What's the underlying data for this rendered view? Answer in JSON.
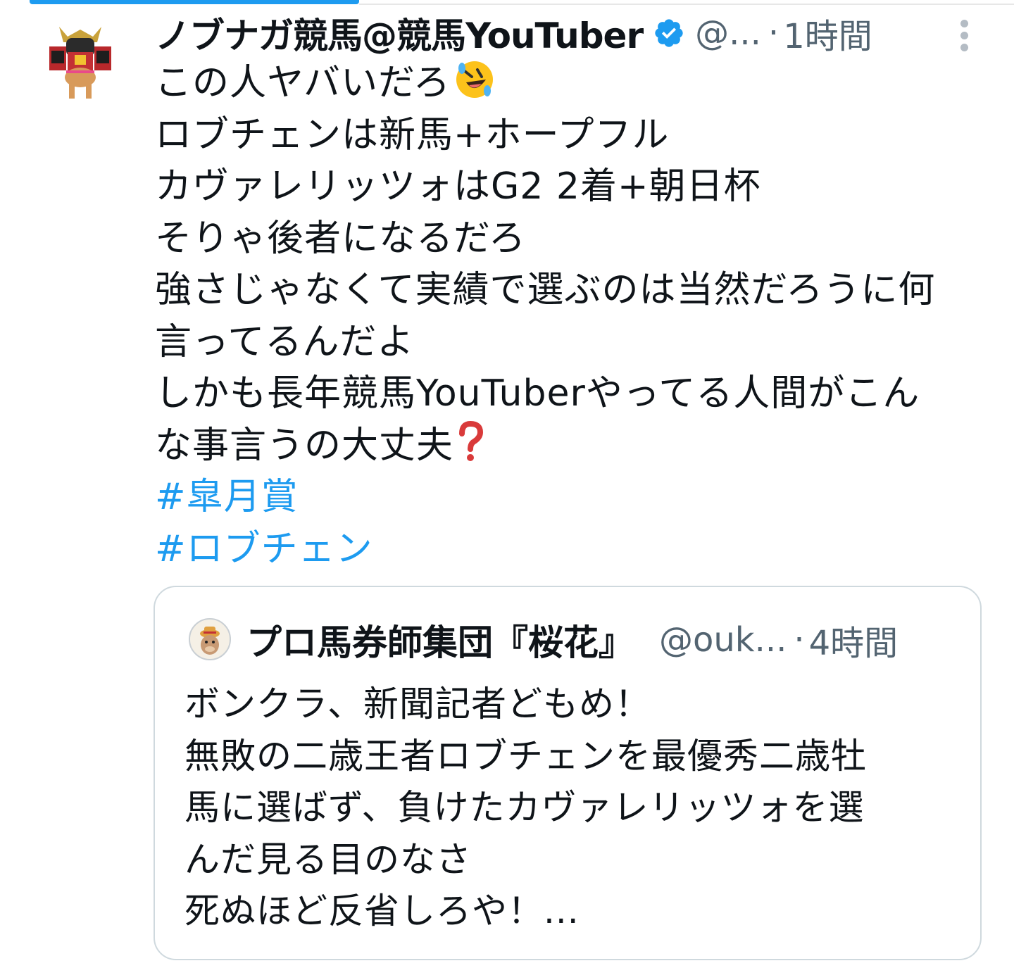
{
  "tweet": {
    "display_name": "ノブナガ競馬@競馬YouTuber",
    "handle": "@...",
    "separator": "·",
    "time": "1時間",
    "verified_icon": "verified-badge-icon",
    "more_icon": "more-vertical-icon",
    "lines": [
      "この人ヤバいだろ",
      "ロブチェンは新馬+ホープフル",
      "カヴァレリッツォはG2 2着+朝日杯",
      "そりゃ後者になるだろ",
      "強さじゃなくて実績で選ぶのは当然だろうに何",
      "言ってるんだよ",
      "しかも長年競馬YouTuberやってる人間がこん",
      "な事言うの大丈夫"
    ],
    "emoji_1": "rolling-on-floor-laughing-emoji",
    "emoji_2": "red-question-mark-emoji",
    "hashtags": [
      "#皐月賞",
      "#ロブチェン"
    ]
  },
  "quote": {
    "display_name": "プロ馬券師集団『桜花』",
    "handle": "@ouk...",
    "separator": "·",
    "time": "4時間",
    "lines": [
      "ボンクラ、新聞記者どもめ！",
      "無敗の二歳王者ロブチェンを最優秀二歳牡",
      "馬に選ばず、負けたカヴァレリッツォを選",
      "んだ見る目のなさ",
      "死ぬほど反省しろや！..."
    ]
  },
  "colors": {
    "accent": "#1d9bf0",
    "secondary_text": "#536471",
    "border": "#cfd9de"
  }
}
